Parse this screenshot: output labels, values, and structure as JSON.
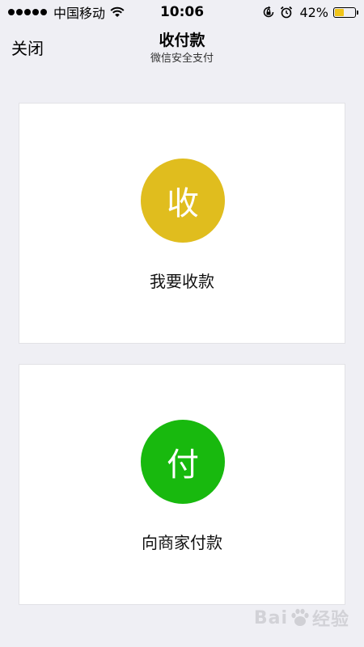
{
  "status_bar": {
    "carrier": "中国移动",
    "time": "10:06",
    "battery_percent": "42%",
    "battery_level": 0.42,
    "icons": [
      "signal-dots-icon",
      "wifi-icon",
      "rotation-lock-icon",
      "alarm-icon",
      "battery-icon"
    ]
  },
  "nav": {
    "close_label": "关闭",
    "title": "收付款",
    "subtitle": "微信安全支付"
  },
  "cards": [
    {
      "icon_char": "收",
      "label": "我要收款",
      "color": "#e0bd1e"
    },
    {
      "icon_char": "付",
      "label": "向商家付款",
      "color": "#18b90e"
    }
  ],
  "watermark": {
    "text_left": "Bai",
    "text_right": "经验",
    "icon": "baidu-paw-icon"
  }
}
